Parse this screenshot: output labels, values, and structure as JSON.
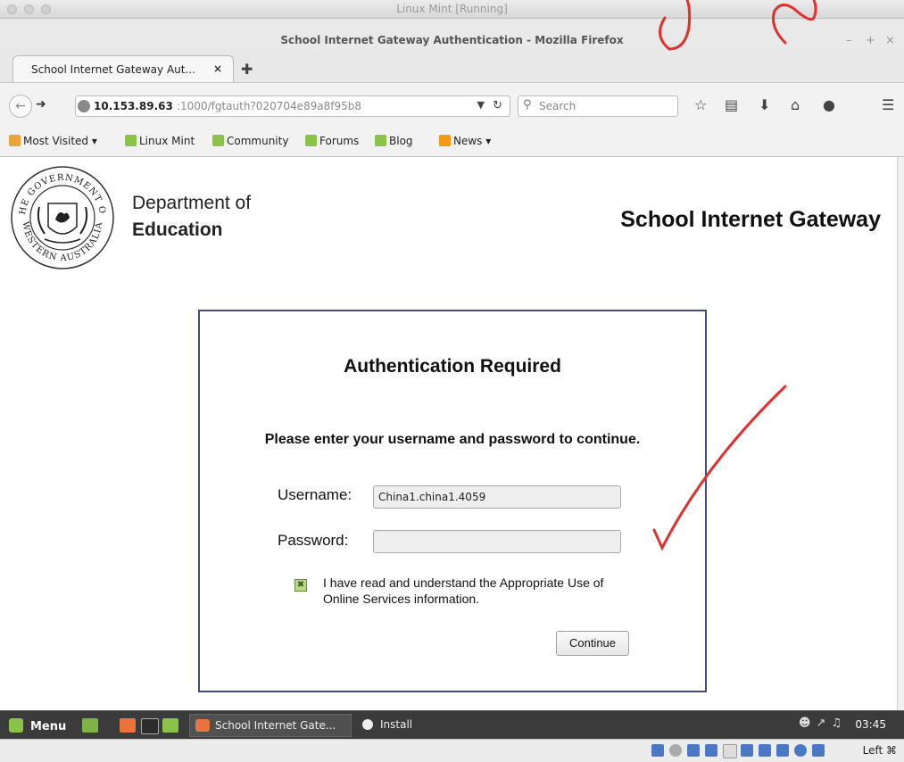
{
  "host_window": {
    "title": "Linux Mint [Running]"
  },
  "firefox": {
    "window_title": "School Internet Gateway Authentication - Mozilla Firefox",
    "window_controls": {
      "minimize": "–",
      "maximize": "+",
      "close": "×"
    },
    "tab": {
      "label": "School Internet Gateway Aut...",
      "close": "×",
      "new_tab": "✚"
    },
    "url": {
      "host": "10.153.89.63",
      "rest": ":1000/fgtauth?020704e89a8f95b8"
    },
    "search": {
      "placeholder": "Search"
    },
    "toolbar_icons": [
      "back-icon",
      "forward-icon",
      "reload-icon",
      "bookmark-star-icon",
      "reading-list-icon",
      "download-icon",
      "home-icon",
      "chat-icon",
      "hamburger-menu-icon"
    ],
    "bookmarks": [
      {
        "label": "Most Visited ▾",
        "icon": "folder-icon"
      },
      {
        "label": "Linux Mint",
        "icon": "mint-icon"
      },
      {
        "label": "Community",
        "icon": "mint-icon"
      },
      {
        "label": "Forums",
        "icon": "mint-icon"
      },
      {
        "label": "Blog",
        "icon": "mint-icon"
      },
      {
        "label": "News ▾",
        "icon": "rss-icon"
      }
    ]
  },
  "page": {
    "seal_text": {
      "top": "THE GOVERNMENT OF",
      "bottom": "WESTERN AUSTRALIA"
    },
    "dept_line1": "Department of",
    "dept_line2": "Education",
    "gateway_title": "School Internet Gateway",
    "auth": {
      "heading": "Authentication Required",
      "message": "Please enter your username and password to continue.",
      "username_label": "Username:",
      "username_value": "China1.china1.4059",
      "password_label": "Password:",
      "password_value": "",
      "agree_checked": true,
      "agree_text": "I have read and understand the Appropriate Use of Online Services information.",
      "continue_label": "Continue"
    }
  },
  "taskbar": {
    "menu_label": "Menu",
    "windows": [
      {
        "label": "School Internet Gate..."
      },
      {
        "label": "Install"
      }
    ],
    "clock": "03:45"
  },
  "vbox_status": {
    "host_key": "Left ⌘"
  }
}
